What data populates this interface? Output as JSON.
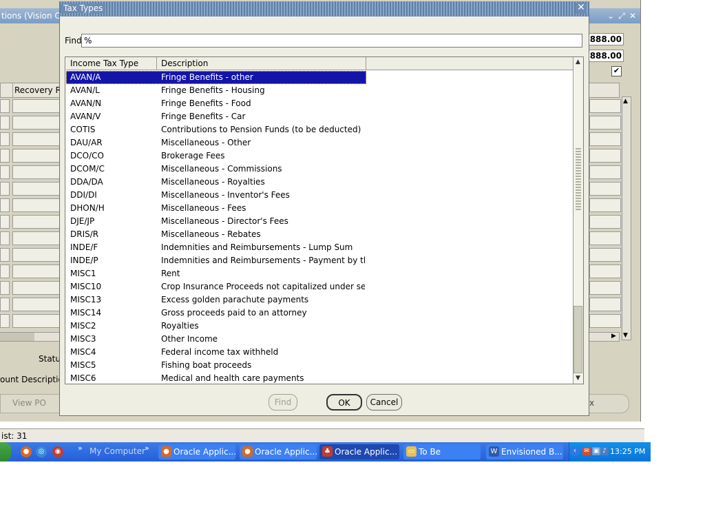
{
  "background_window": {
    "title": "tions (Vision Op",
    "value_1": "888.00",
    "value_2": "888.00",
    "check_mark": "✔",
    "column_header": "Recovery R",
    "status_label": "Statu",
    "account_label": "ount Descriptio",
    "view_po_label": "View PO",
    "x_label": "x",
    "list_count": "ist: 31"
  },
  "dialog": {
    "title": "Tax Types",
    "find_label": "Find",
    "find_value": "%",
    "columns": [
      "Income Tax Type",
      "Description"
    ],
    "selected_index": 0,
    "rows": [
      {
        "type": "AVAN/A",
        "description": "Fringe Benefits - other"
      },
      {
        "type": "AVAN/L",
        "description": "Fringe Benefits - Housing"
      },
      {
        "type": "AVAN/N",
        "description": "Fringe Benefits - Food"
      },
      {
        "type": "AVAN/V",
        "description": "Fringe Benefits - Car"
      },
      {
        "type": "COTIS",
        "description": "Contributions to Pension Funds (to be deducted)"
      },
      {
        "type": "DAU/AR",
        "description": "Miscellaneous - Other"
      },
      {
        "type": "DCO/CO",
        "description": "Brokerage Fees"
      },
      {
        "type": "DCOM/C",
        "description": "Miscellaneous - Commissions"
      },
      {
        "type": "DDA/DA",
        "description": "Miscellaneous - Royalties"
      },
      {
        "type": "DDI/DI",
        "description": "Miscellaneous - Inventor's Fees"
      },
      {
        "type": "DHON/H",
        "description": "Miscellaneous - Fees"
      },
      {
        "type": "DJE/JP",
        "description": "Miscellaneous - Director's Fees"
      },
      {
        "type": "DRIS/R",
        "description": "Miscellaneous - Rebates"
      },
      {
        "type": "INDE/F",
        "description": "Indemnities and Reimbursements - Lump Sum"
      },
      {
        "type": "INDE/P",
        "description": "Indemnities and Reimbursements - Payment by the..."
      },
      {
        "type": "MISC1",
        "description": "Rent"
      },
      {
        "type": "MISC10",
        "description": "Crop Insurance Proceeds not capitalized under sec..."
      },
      {
        "type": "MISC13",
        "description": "Excess golden parachute payments"
      },
      {
        "type": "MISC14",
        "description": "Gross proceeds paid to an attorney"
      },
      {
        "type": "MISC2",
        "description": "Royalties"
      },
      {
        "type": "MISC3",
        "description": "Other Income"
      },
      {
        "type": "MISC4",
        "description": "Federal income tax withheld"
      },
      {
        "type": "MISC5",
        "description": "Fishing boat proceeds"
      },
      {
        "type": "MISC6",
        "description": "Medical and health care payments"
      }
    ],
    "buttons": {
      "find": "Find",
      "ok": "OK",
      "cancel": "Cancel"
    }
  },
  "taskbar": {
    "chevron": "»",
    "quick_launch_label": "My Computer",
    "items": [
      {
        "label": "Oracle Applic...",
        "active": false,
        "icon": "firefox-icon"
      },
      {
        "label": "Oracle Applic...",
        "active": false,
        "icon": "firefox-icon"
      },
      {
        "label": "Oracle Applic...",
        "active": true,
        "icon": "oracle-applet-icon"
      },
      {
        "label": "To Be",
        "active": false,
        "icon": "folder-icon"
      },
      {
        "label": "Envisioned B...",
        "active": false,
        "icon": "word-icon"
      }
    ],
    "clock": "13:25 PM"
  },
  "colors": {
    "selection": "#1414a8",
    "dialog_bg": "#efeee3",
    "taskbar": "#245edc",
    "tray": "#0c74d8"
  }
}
